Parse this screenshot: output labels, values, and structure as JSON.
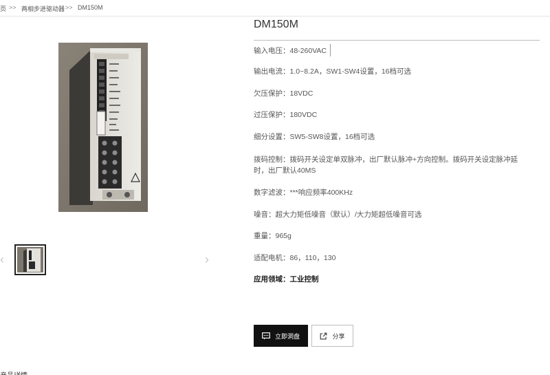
{
  "breadcrumb": {
    "home_fragment": "页",
    "sep1": ">>",
    "category": "两相步进驱动器",
    "sep2": ">>",
    "current": "DM150M"
  },
  "product": {
    "title": "DM150M",
    "specs": [
      "输入电压：48-260VAC",
      "输出电流：1.0~8.2A，SW1-SW4设置，16档可选",
      "欠压保护：18VDC",
      "过压保护：180VDC",
      "细分设置：SW5-SW8设置，16档可选",
      "拨码控制：拨码开关设定单双脉冲，出厂默认脉冲+方向控制。拨码开关设定脉冲延时，出厂默认40MS",
      "数字滤波：***响应频率400KHz",
      "噪音：超大力矩低噪音（默认）/大力矩超低噪音可选",
      "重量：965g",
      "适配电机：86，110，130",
      "应用领域：工业控制"
    ]
  },
  "gallery": {
    "prev_arrow": "‹",
    "next_arrow": "›",
    "photo_icon": "stepper-driver-photo",
    "thumb_icon": "stepper-driver-thumbnail"
  },
  "actions": {
    "consult_label": "立即洞盘",
    "share_label": "分享",
    "consult_icon": "chat-icon",
    "share_icon": "share-icon"
  },
  "tabs": {
    "details_label": "产品详情"
  },
  "colors": {
    "primary_button": "#111111",
    "rule": "#bdbdbd",
    "text": "#555555"
  }
}
